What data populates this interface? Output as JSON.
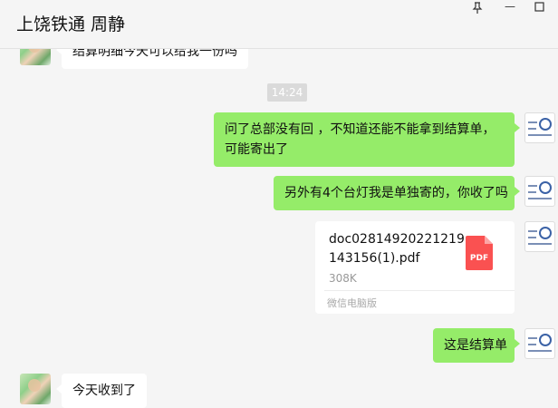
{
  "header": {
    "title": "上饶铁通 周静"
  },
  "window_controls": {
    "pin_icon": "pin-icon",
    "minimize_glyph": "—",
    "maximize_icon": "maximize-icon"
  },
  "messages": [
    {
      "side": "left",
      "text": "结算明细今天可以给我一份吗"
    },
    {
      "type": "timestamp",
      "text": "14:24"
    },
    {
      "side": "right",
      "text": "问了总部没有回 ，不知道还能不能拿到结算单，可能寄出了"
    },
    {
      "side": "right",
      "text": "另外有4个台灯我是单独寄的，你收了吗"
    },
    {
      "side": "right",
      "type": "file",
      "file_name": "doc02814920221219143156(1).pdf",
      "file_size": "308K",
      "file_source": "微信电脑版",
      "file_icon": "pdf-icon",
      "file_badge": "PDF"
    },
    {
      "side": "right",
      "text": "这是结算单"
    },
    {
      "side": "left",
      "text": "今天收到了"
    }
  ],
  "colors": {
    "background": "#f5f5f5",
    "bubble_right": "#95ec69",
    "bubble_left": "#ffffff",
    "pdf_red": "#fa5151"
  }
}
